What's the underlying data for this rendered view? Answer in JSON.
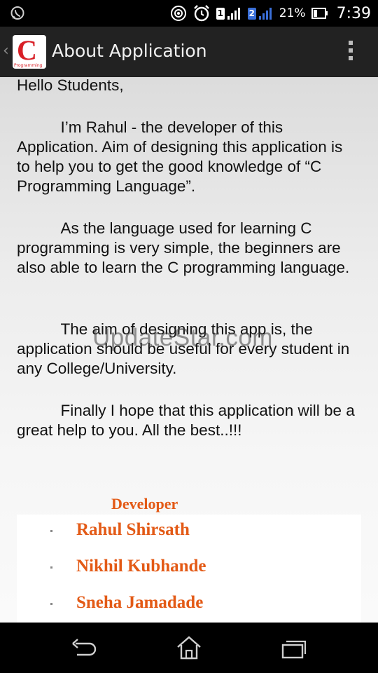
{
  "status_bar": {
    "battery_percent": "21%",
    "time": "7:39",
    "sim1": "1",
    "sim2": "2",
    "icons": [
      "whatsapp-icon",
      "sync-icon",
      "alarm-icon",
      "sim1-signal-icon",
      "sim2-signal-icon",
      "battery-icon"
    ]
  },
  "action_bar": {
    "title": "About Application",
    "logo_letter": "C",
    "logo_caption": "Programming"
  },
  "content": {
    "greeting": "Hello Students,",
    "paragraph1": "          I’m Rahul -  the developer of this Application. Aim of designing this application  is  to help you to get  the  good knowledge  of  “C Programming Language”.",
    "paragraph2": "          As the language used  for learning C programming is very simple, the beginners are also able to learn the C programming language.",
    "paragraph3": "          The aim of designing this app is, the application should be useful for every student in any College/University.",
    "paragraph4": "          Finally I hope that this application will be a great help to you. All the best..!!!",
    "watermark": "UpdateStar.com"
  },
  "developers": {
    "heading": "Developer",
    "names": [
      "Rahul Shirsath",
      "Nikhil Kubhande",
      "Sneha Jamadade"
    ]
  },
  "colors": {
    "accent_orange": "#e35a16",
    "action_bar_bg": "#222222",
    "logo_red": "#d81f26"
  },
  "nav_bar": {
    "icons": [
      "back-icon",
      "home-icon",
      "recent-apps-icon"
    ]
  }
}
